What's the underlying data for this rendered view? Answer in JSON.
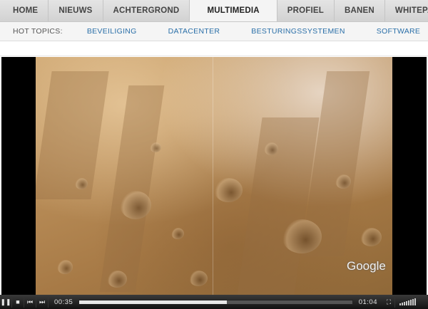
{
  "nav": {
    "items": [
      "HOME",
      "NIEUWS",
      "ACHTERGROND",
      "MULTIMEDIA",
      "PROFIEL",
      "BANEN",
      "WHITEPAPE"
    ],
    "active_index": 3
  },
  "hot_topics": {
    "label": "HOT TOPICS:",
    "items": [
      "BEVEILIGING",
      "DATACENTER",
      "BESTURINGSSYSTEMEN",
      "SOFTWARE"
    ]
  },
  "video": {
    "watermark": "Google",
    "icons": [
      "pause-icon",
      "stop-icon",
      "previous-icon",
      "next-icon",
      "fullscreen-icon",
      "volume-icon"
    ]
  },
  "player": {
    "elapsed": "00:35",
    "duration": "01:04",
    "progress": 0.54
  },
  "colors": {
    "link": "#2a6fa8",
    "nav_bg": "#d8d8d8",
    "player_bg": "#1e1e1e"
  }
}
